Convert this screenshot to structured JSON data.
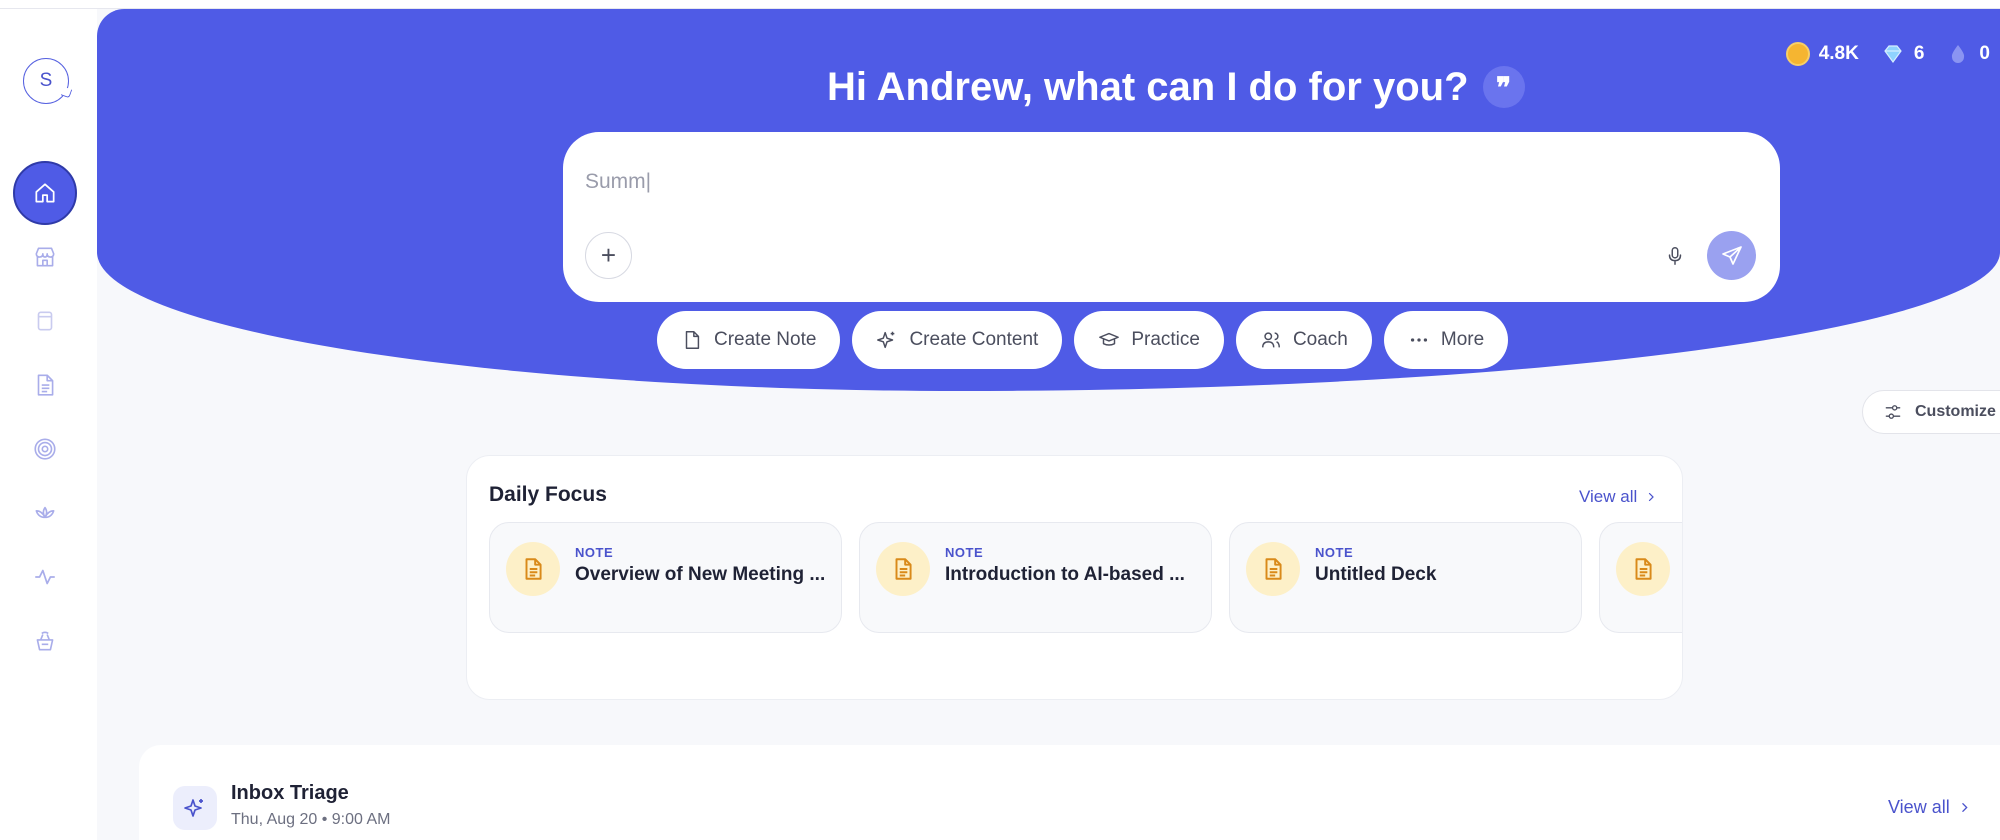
{
  "sidebar": {
    "avatar_letter": "S",
    "items": [
      {
        "name": "home",
        "icon": "home-icon",
        "active": true
      },
      {
        "name": "store",
        "icon": "store-icon",
        "active": false
      },
      {
        "name": "library",
        "icon": "box-icon",
        "active": false
      },
      {
        "name": "notes",
        "icon": "document-icon",
        "active": false
      },
      {
        "name": "goals",
        "icon": "target-icon",
        "active": false
      },
      {
        "name": "wellness",
        "icon": "lotus-icon",
        "active": false
      },
      {
        "name": "activity",
        "icon": "activity-icon",
        "active": false
      },
      {
        "name": "rewards",
        "icon": "basket-icon",
        "active": false
      }
    ]
  },
  "header": {
    "greeting": "Hi Andrew, what can I do for you?",
    "quote_badge": "99"
  },
  "stats": {
    "coins": "4.8K",
    "gems": "6",
    "drops": "0"
  },
  "prompt": {
    "value": "Summ|"
  },
  "actions": [
    {
      "label": "Create Note",
      "icon": "note-icon"
    },
    {
      "label": "Create Content",
      "icon": "sparkle-icon"
    },
    {
      "label": "Practice",
      "icon": "graduation-cap-icon"
    },
    {
      "label": "Coach",
      "icon": "users-icon"
    },
    {
      "label": "More",
      "icon": "more-dots-icon"
    }
  ],
  "customize_label": "Customize",
  "daily_focus": {
    "title": "Daily Focus",
    "view_all": "View all",
    "cards": [
      {
        "kind": "NOTE",
        "title": "Overview of New Meeting ..."
      },
      {
        "kind": "NOTE",
        "title": "Introduction to AI-based ..."
      },
      {
        "kind": "NOTE",
        "title": "Untitled Deck"
      },
      {
        "kind": "",
        "title": ""
      }
    ]
  },
  "inbox": {
    "title": "Inbox Triage",
    "subtitle": "Thu, Aug 20 • 9:00 AM",
    "view_all": "View all"
  },
  "colors": {
    "accent": "#4f5be6",
    "card_icon_bg": "#fdf0c8",
    "card_icon": "#d98a1a"
  }
}
